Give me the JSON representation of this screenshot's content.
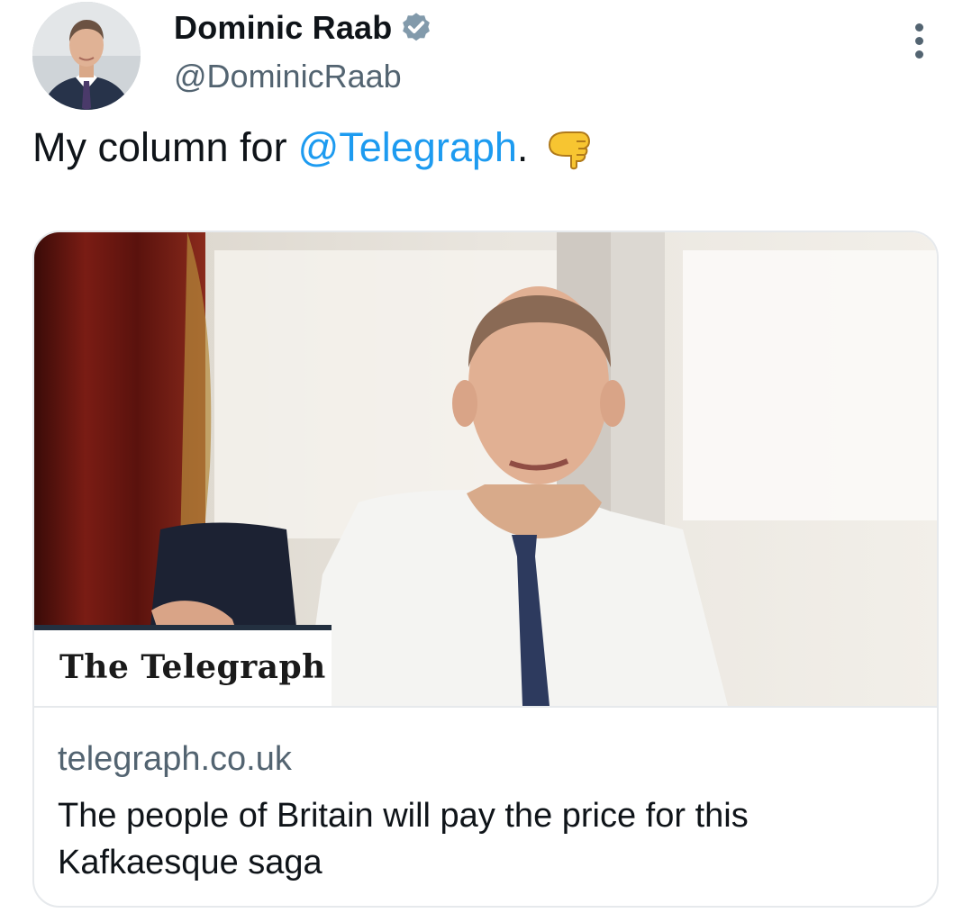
{
  "author": {
    "display_name": "Dominic Raab",
    "handle": "@DominicRaab",
    "verified": true,
    "avatar_icon": "profile-photo"
  },
  "tweet": {
    "text_prefix": "My column for",
    "mention": "@Telegraph",
    "text_suffix": ".",
    "emoji": "backhand-index-pointing-down"
  },
  "menu": {
    "icon": "more-vertical-icon"
  },
  "card": {
    "brand": "The Telegraph",
    "domain": "telegraph.co.uk",
    "title": "The people of Britain will pay the price for this Kafkaesque saga"
  },
  "colors": {
    "link": "#1d9bf0",
    "secondary_text": "#536471",
    "primary_text": "#0f1419",
    "verified_badge": "#829aab",
    "border": "#e6e9ec"
  }
}
